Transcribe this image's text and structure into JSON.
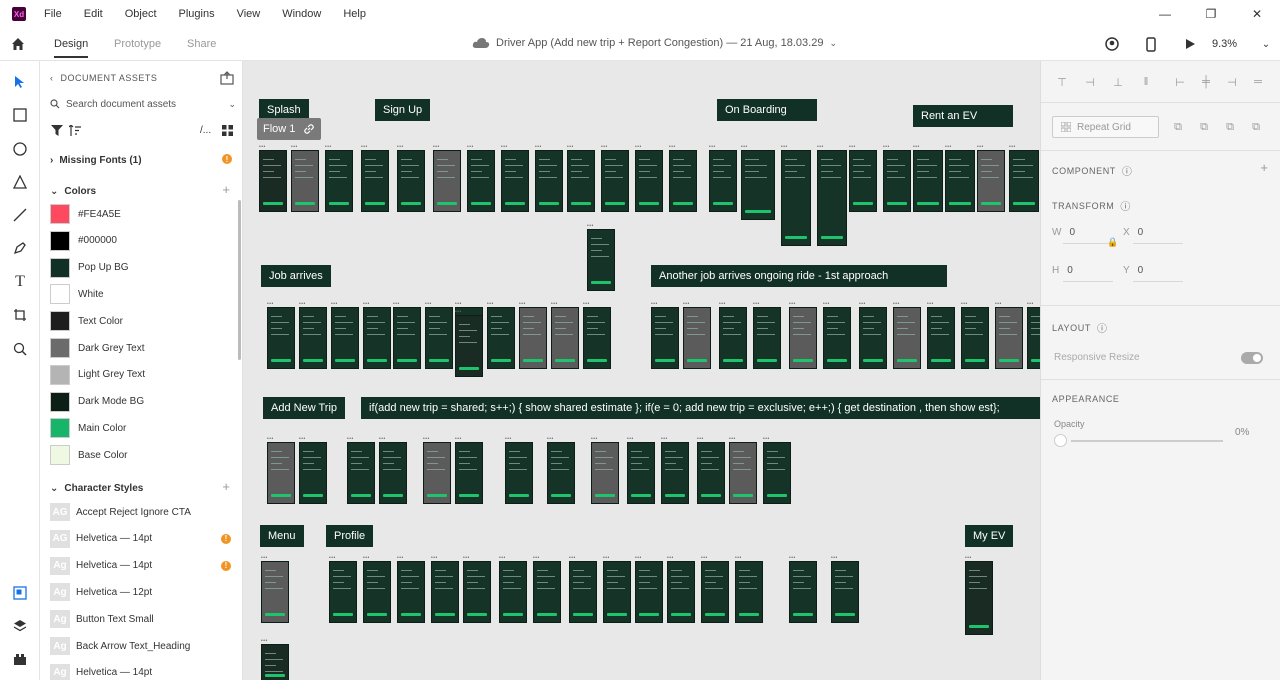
{
  "app": {
    "logo_text": "Xd"
  },
  "menu": [
    "File",
    "Edit",
    "Object",
    "Plugins",
    "View",
    "Window",
    "Help"
  ],
  "window_controls": {
    "minimize": "—",
    "restore": "❐",
    "close": "✕"
  },
  "toolbar": {
    "tabs": [
      "Design",
      "Prototype",
      "Share"
    ],
    "doc_title": "Driver App (Add new trip + Report Congestion) — 21 Aug, 18.03.29",
    "zoom": "9.3%"
  },
  "assets": {
    "header": "DOCUMENT ASSETS",
    "search_placeholder": "Search document assets",
    "missing_fonts": "Missing Fonts (1)",
    "colors_title": "Colors",
    "colors": [
      {
        "label": "#FE4A5E",
        "hex": "#FE4A5E"
      },
      {
        "label": "#000000",
        "hex": "#000000"
      },
      {
        "label": "Pop Up BG",
        "hex": "#123126"
      },
      {
        "label": "White",
        "hex": "#FFFFFF"
      },
      {
        "label": "Text Color",
        "hex": "#1E1E1E"
      },
      {
        "label": "Dark Grey Text",
        "hex": "#6B6B6B"
      },
      {
        "label": "Light Grey Text",
        "hex": "#B4B4B4"
      },
      {
        "label": "Dark Mode BG",
        "hex": "#0C1F17"
      },
      {
        "label": "Main Color",
        "hex": "#16B56A"
      },
      {
        "label": "Base Color",
        "hex": "#EEF8E2"
      }
    ],
    "char_styles_title": "Character Styles",
    "char_styles": [
      {
        "label": "Accept Reject Ignore CTA",
        "glyph": "AG",
        "warn": false
      },
      {
        "label": "Helvetica — 14pt",
        "glyph": "AG",
        "warn": true
      },
      {
        "label": "Helvetica — 14pt",
        "glyph": "Ag",
        "warn": true
      },
      {
        "label": "Helvetica — 12pt",
        "glyph": "Ag",
        "warn": false
      },
      {
        "label": "Button Text Small",
        "glyph": "Ag",
        "warn": false
      },
      {
        "label": "Back Arrow Text_Heading",
        "glyph": "Ag",
        "warn": false
      },
      {
        "label": "Helvetica — 14pt",
        "glyph": "Ag",
        "warn": false
      }
    ]
  },
  "canvas": {
    "flow_chip": "Flow 1",
    "labels": {
      "splash": "Splash",
      "signup": "Sign Up",
      "onboarding": "On Boarding",
      "rent_ev": "Rent an EV",
      "job_arrives": "Job arrives",
      "another_job": "Another job arrives ongoing ride - 1st approach",
      "add_new_trip": "Add New Trip",
      "add_trip_logic": "if(add new trip = shared; s++;) { show shared estimate }; if(e = 0; add new trip = exclusive; e++;) { get destination , then show est};",
      "menu": "Menu",
      "profile": "Profile",
      "my_ev": "My EV"
    }
  },
  "inspector": {
    "repeat_grid": "Repeat Grid",
    "component": "COMPONENT",
    "transform": "TRANSFORM",
    "w_label": "W",
    "w_value": "0",
    "x_label": "X",
    "x_value": "0",
    "h_label": "H",
    "h_value": "0",
    "y_label": "Y",
    "y_value": "0",
    "layout": "LAYOUT",
    "responsive_resize": "Responsive Resize",
    "appearance": "APPEARANCE",
    "opacity_label": "Opacity",
    "opacity_value": "0%"
  }
}
